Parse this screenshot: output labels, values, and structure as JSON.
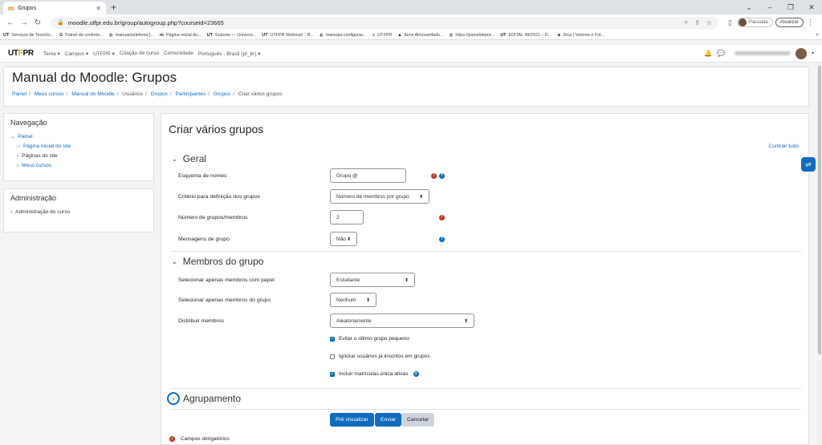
{
  "browser": {
    "tab_title": "Grupos",
    "url": "moodle.utfpr.edu.br/group/autogroup.php?courseid=23665",
    "paused_label": "Pausada",
    "update_label": "Atualizar",
    "bookmarks": [
      "Serviços de Tecnolo...",
      "Painel de controle...",
      "manuaistelefonia [...",
      "Página inicial do...",
      "Suporte — Universi...",
      "UTFPR Webmail :: B...",
      "manuais:configurac...",
      "UTFPR",
      "Itens Almoxarifado...",
      "https://paineldepre...",
      "EDITAL 49/2021 – D...",
      "Dica | Vetores e Fot..."
    ]
  },
  "navbar": {
    "logo_a": "UT",
    "logo_b": "F",
    "logo_c": "PR",
    "menu": [
      "Tema ▾",
      "Campus ▾",
      "UTFPR ▾",
      "Criação de curso",
      "Comunidade",
      "Português - Brasil (pt_br) ▾"
    ]
  },
  "header": {
    "title": "Manual do Moodle: Grupos",
    "breadcrumbs": [
      "Painel",
      "Meus cursos",
      "Manual do Moodle",
      "Usuários",
      "Grupos",
      "Participantes",
      "Grupos",
      "Criar vários grupos"
    ]
  },
  "nav_block": {
    "title": "Navegação",
    "root": "Painel",
    "home": "Página inicial do site",
    "pages": "Páginas do site",
    "courses": "Meus cursos"
  },
  "admin_block": {
    "title": "Administração",
    "item": "Administração do curso"
  },
  "form": {
    "title": "Criar vários grupos",
    "expand_all": "Contrair tudo",
    "general": {
      "heading": "Geral",
      "naming_label": "Esquema de nomes",
      "naming_value": "Grupo @",
      "criterion_label": "Critério para definição dos grupos",
      "criterion_value": "Número de membros por grupo",
      "number_label": "Número de grupos/membros",
      "number_value": "2",
      "messaging_label": "Mensagens de grupo",
      "messaging_value": "Não"
    },
    "members": {
      "heading": "Membros do grupo",
      "role_label": "Selecionar apenas membros com papel",
      "role_value": "Estudante",
      "group_label": "Selecionar apenas membros do grupo",
      "group_value": "Nenhum",
      "allocate_label": "Distribuir membros",
      "allocate_value": "Aleatoriamente",
      "check_last_small": "Evitar o último grupo pequeno",
      "check_ignore": "Ignorar usuários já inscritos em grupos",
      "check_include_active": "Incluir matrículas única ativas"
    },
    "grouping": {
      "heading": "Agrupamento"
    },
    "buttons": {
      "preview": "Pré visualizar",
      "submit": "Enviar",
      "cancel": "Cancelar"
    },
    "required_note": "Campos obrigatórios"
  }
}
